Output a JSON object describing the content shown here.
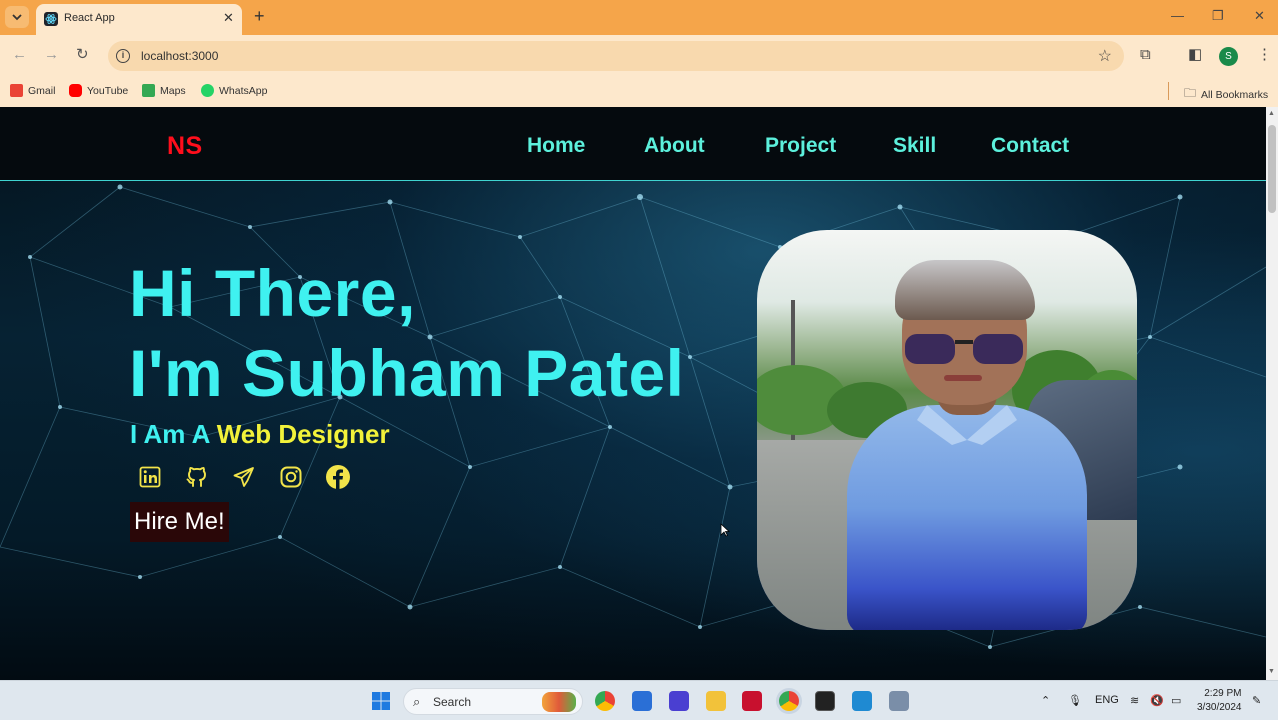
{
  "browser": {
    "tab_title": "React App",
    "url": "localhost:3000",
    "bookmarks": [
      {
        "label": "Gmail",
        "color": "#ea4335"
      },
      {
        "label": "YouTube",
        "color": "#ff0000"
      },
      {
        "label": "Maps",
        "color": "#34a853"
      },
      {
        "label": "WhatsApp",
        "color": "#25d366"
      }
    ],
    "all_bookmarks": "All Bookmarks",
    "profile_initial": "S"
  },
  "site": {
    "logo": "NS",
    "nav": [
      "Home",
      "About",
      "Project",
      "Skill",
      "Contact"
    ],
    "hero": {
      "line1": "Hi There,",
      "line2": "I'm Subham Patel",
      "role_prefix": "I Am A",
      "role_value": "Web Designer",
      "hire_label": "Hire Me!"
    },
    "socials": [
      "linkedin-icon",
      "github-icon",
      "telegram-icon",
      "instagram-icon",
      "facebook-icon"
    ],
    "colors": {
      "accent": "#3ff1f0",
      "logo": "#ff0e1c",
      "role": "#f2f23a",
      "social": "#f2e44a"
    }
  },
  "taskbar": {
    "search_label": "Search",
    "language": "ENG",
    "time": "2:29 PM",
    "date": "3/30/2024"
  }
}
